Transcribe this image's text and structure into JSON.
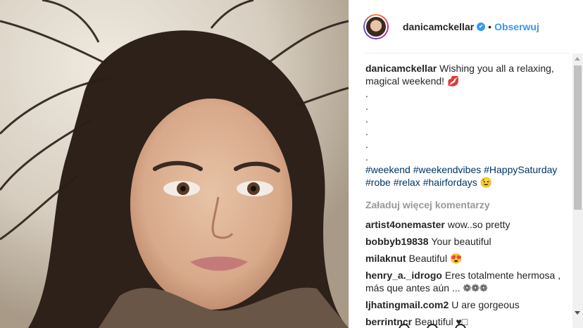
{
  "post": {
    "username": "danicamckellar",
    "verified_badge": "✔",
    "separator": "•",
    "follow_label": "Obserwuj",
    "caption": {
      "username": "danicamckellar",
      "text": "Wishing you all a relaxing, magical weekend! 💋",
      "dots": [
        ".",
        ".",
        ".",
        ".",
        ".",
        "."
      ],
      "hashtags": [
        "#weekend",
        "#weekendvibes",
        "#HappySaturday",
        "#robe",
        "#relax",
        "#hairfordays"
      ],
      "hashtags_trailing_emoji": "😉"
    },
    "load_more_label": "Załaduj więcej komentarzy",
    "comments": [
      {
        "username": "artist4onemaster",
        "text": "wow..so pretty"
      },
      {
        "username": "bobbyb19838",
        "text": "Your beautiful"
      },
      {
        "username": "milaknut",
        "text": "Beautiful 😍"
      },
      {
        "username": "henry_a._idrogo",
        "text": "Eres totalmente hermosa , más que antes aún ... ❁❁❁"
      },
      {
        "username": "ljhatingmail.com2",
        "text": "U are gorgeous"
      },
      {
        "username": "berrintncr",
        "text": "Beautiful ♥□"
      }
    ]
  },
  "colors": {
    "link": "#003569",
    "follow": "#3897f0",
    "muted": "#999999"
  },
  "icons": {
    "verified": "verified-badge-icon",
    "avatar": "profile-avatar"
  }
}
